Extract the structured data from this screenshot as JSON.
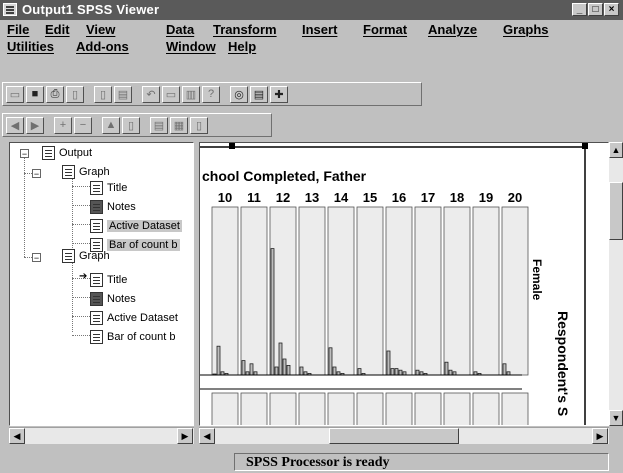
{
  "window": {
    "title": "Output1  SPSS Viewer",
    "controls": [
      "_",
      "□",
      "×"
    ]
  },
  "menu_row1": [
    "File",
    "Edit",
    "View",
    "Data",
    "Transform",
    "Insert",
    "Format",
    "Analyze",
    "Graphs"
  ],
  "menu_row2": [
    "Utilities",
    "Add-ons",
    "Window",
    "Help"
  ],
  "toolbar1_icons": [
    "open-icon",
    "save-icon",
    "print-icon",
    "print-preview-icon",
    "export-icon",
    "dialog-recall-icon",
    "undo-icon",
    "goto-data-icon",
    "goto-chart-icon",
    "variables-icon",
    "spss-icon",
    "select-last-output-icon",
    "designate-window-icon"
  ],
  "toolbar2_icons": [
    "promote-icon",
    "demote-icon",
    "expand-icon",
    "collapse-icon",
    "show-icon",
    "hide-icon",
    "insert-heading-icon",
    "insert-title-icon",
    "insert-text-icon"
  ],
  "outline": {
    "root": "Output",
    "groups": [
      {
        "label": "Graph",
        "items": [
          "Title",
          "Notes",
          "Active Dataset",
          "Bar of count b"
        ]
      },
      {
        "label": "Graph",
        "items": [
          "Title",
          "Notes",
          "Active Dataset",
          "Bar of count b"
        ]
      }
    ]
  },
  "chart": {
    "title": "chool Completed, Father",
    "panel_label": "Female",
    "side_label": "Respondent's S",
    "ticks": [
      "10",
      "11",
      "12",
      "13",
      "14",
      "15",
      "16",
      "17",
      "18",
      "19",
      "20"
    ]
  },
  "chart_data": {
    "type": "bar",
    "title": "chool Completed, Father",
    "categories": [
      "10",
      "11",
      "12",
      "13",
      "14",
      "15",
      "16",
      "17",
      "18",
      "19",
      "20"
    ],
    "panel": "Female",
    "heights": [
      [
        0.0,
        0.18,
        0.02,
        0.01
      ],
      [
        0.09,
        0.02,
        0.07,
        0.02
      ],
      [
        0.79,
        0.05,
        0.2,
        0.1,
        0.06
      ],
      [
        0.05,
        0.02,
        0.01
      ],
      [
        0.17,
        0.05,
        0.02,
        0.01
      ],
      [
        0.04,
        0.01
      ],
      [
        0.15,
        0.04,
        0.04,
        0.03,
        0.02
      ],
      [
        0.03,
        0.02,
        0.01
      ],
      [
        0.08,
        0.03,
        0.02
      ],
      [
        0.02,
        0.01
      ],
      [
        0.07,
        0.02
      ]
    ]
  },
  "status": {
    "text": "SPSS Processor is ready"
  }
}
